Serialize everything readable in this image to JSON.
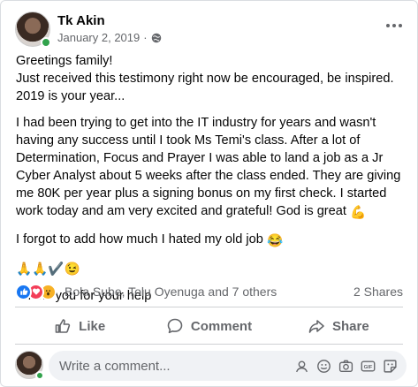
{
  "post": {
    "author": "Tk Akin",
    "date": "January 2, 2019",
    "separator": "·",
    "privacy_icon": "globe-icon",
    "paragraphs": [
      "Greetings family!",
      "Just received this testimony right now be encouraged, be inspired. 2019 is your year...",
      "I had been trying to get into the IT industry for years and wasn't having any success until I took Ms Temi's class. After a lot of Determination, Focus and Prayer I was able to land a job as a Jr Cyber Analyst about 5 weeks after the class ended. They are giving me 80K per year plus a signing bonus on my first check. I started work today and am very excited and grateful! God is great",
      "I forgot to add how much I hated my old job",
      "",
      "Thank you for your help"
    ],
    "emojis": {
      "muscle": "💪",
      "laugh": "😂",
      "hands_line": "🙏🙏✔️😉"
    }
  },
  "reactions": {
    "names": "Bola Sube, Tolu Oyenuga and 7 others",
    "shares": "2 Shares",
    "types": [
      "like",
      "love",
      "wow"
    ]
  },
  "actions": {
    "like": "Like",
    "comment": "Comment",
    "share": "Share"
  },
  "comment_box": {
    "placeholder": "Write a comment..."
  },
  "colors": {
    "accent": "#1877f2",
    "secondary_text": "#65676b",
    "online": "#31a24c"
  }
}
